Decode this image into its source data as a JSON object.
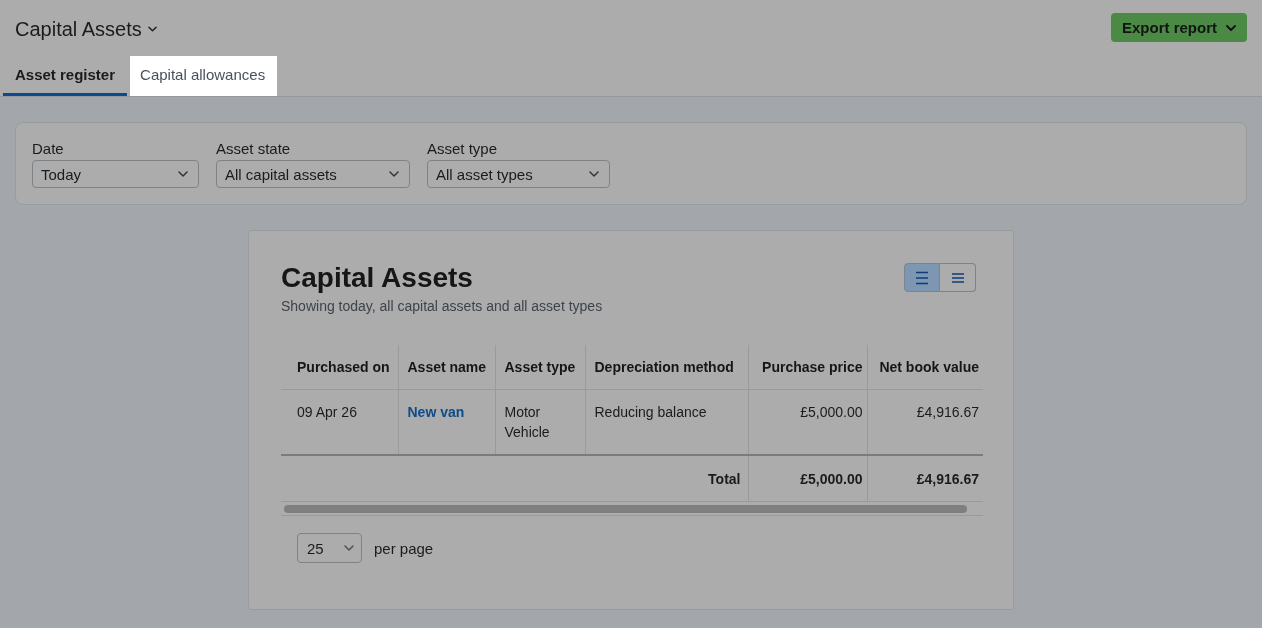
{
  "header": {
    "title": "Capital Assets",
    "export_button": "Export report"
  },
  "tabs": [
    {
      "label": "Asset register",
      "selected": true,
      "highlighted": false
    },
    {
      "label": "Capital allowances",
      "selected": false,
      "highlighted": true
    }
  ],
  "filters": [
    {
      "label": "Date",
      "value": "Today"
    },
    {
      "label": "Asset state",
      "value": "All capital assets"
    },
    {
      "label": "Asset type",
      "value": "All asset types"
    }
  ],
  "report": {
    "title": "Capital Assets",
    "subtitle": "Showing today, all capital assets and all asset types",
    "view_options": [
      {
        "kind": "comfortable",
        "selected": true
      },
      {
        "kind": "compact",
        "selected": false
      }
    ],
    "table": {
      "columns": [
        {
          "label": "Purchased on",
          "kind": "text"
        },
        {
          "label": "Asset name",
          "kind": "link"
        },
        {
          "label": "Asset type",
          "kind": "text"
        },
        {
          "label": "Depreciation method",
          "kind": "text"
        },
        {
          "label": "Purchase price",
          "kind": "money"
        },
        {
          "label": "Net book value",
          "kind": "money"
        }
      ],
      "rows": [
        [
          "09 Apr 26",
          "New van",
          "Motor Vehicle",
          "Reducing balance",
          "£5,000.00",
          "£4,916.67"
        ]
      ],
      "total": {
        "label": "Total",
        "values": [
          "£5,000.00",
          "£4,916.67"
        ]
      }
    },
    "pagination": {
      "page_size": "25",
      "label": "per page"
    }
  }
}
